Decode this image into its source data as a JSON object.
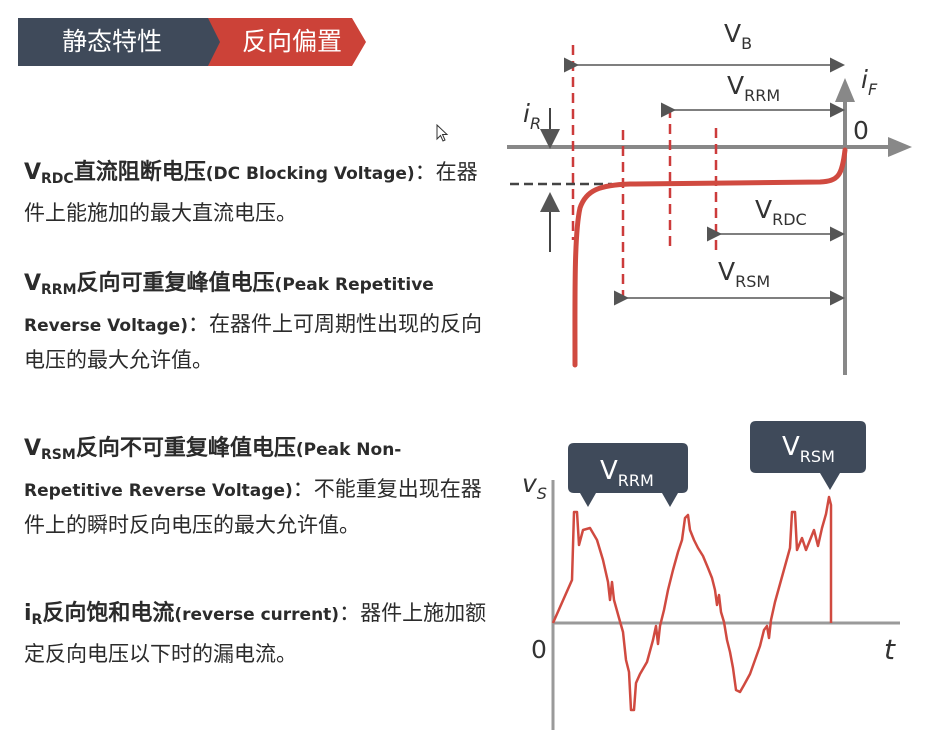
{
  "tabs": {
    "tab1": "静态特性",
    "tab2": "反向偏置",
    "tab1_color": "#3f4a5a",
    "tab2_color": "#cc4238"
  },
  "desc": {
    "vrdc": {
      "sym": "V",
      "sub": "RDC",
      "cn": "直流阻断电压",
      "en": "(DC Blocking Voltage)",
      "body": "：在器件上能施加的最大直流电压。"
    },
    "vrrm": {
      "sym": "V",
      "sub": "RRM",
      "cn": "反向可重复峰值电压",
      "en": "(Peak Repetitive Reverse Voltage)",
      "body": "：在器件上可周期性出现的反向电压的最大允许值。"
    },
    "vrsm": {
      "sym": "V",
      "sub": "RSM",
      "cn": "反向不可重复峰值电压",
      "en": "(Peak Non-Repetitive Reverse Voltage)",
      "body": "：不能重复出现在器件上的瞬时反向电压的最大允许值。"
    },
    "ir": {
      "sym": "i",
      "sub": "R",
      "cn": "反向饱和电流",
      "en": "(reverse current)",
      "body": "：器件上施加额定反向电压以下时的漏电流。"
    }
  },
  "diagram1": {
    "vb": "V",
    "vb_sub": "B",
    "vrrm": "V",
    "vrrm_sub": "RRM",
    "vrdc": "V",
    "vrdc_sub": "RDC",
    "vrsm": "V",
    "vrsm_sub": "RSM",
    "ir": "i",
    "ir_sub": "R",
    "if": "i",
    "if_sub": "F",
    "origin": "0"
  },
  "diagram2": {
    "vs": "v",
    "vs_sub": "S",
    "t": "t",
    "origin": "0",
    "bubble1": "V",
    "bubble1_sub": "RRM",
    "bubble2": "V",
    "bubble2_sub": "RSM"
  },
  "colors": {
    "curve": "#d04a40",
    "axis": "#888888",
    "dash": "#cc3b3b",
    "bubble": "#3f4a5a"
  }
}
